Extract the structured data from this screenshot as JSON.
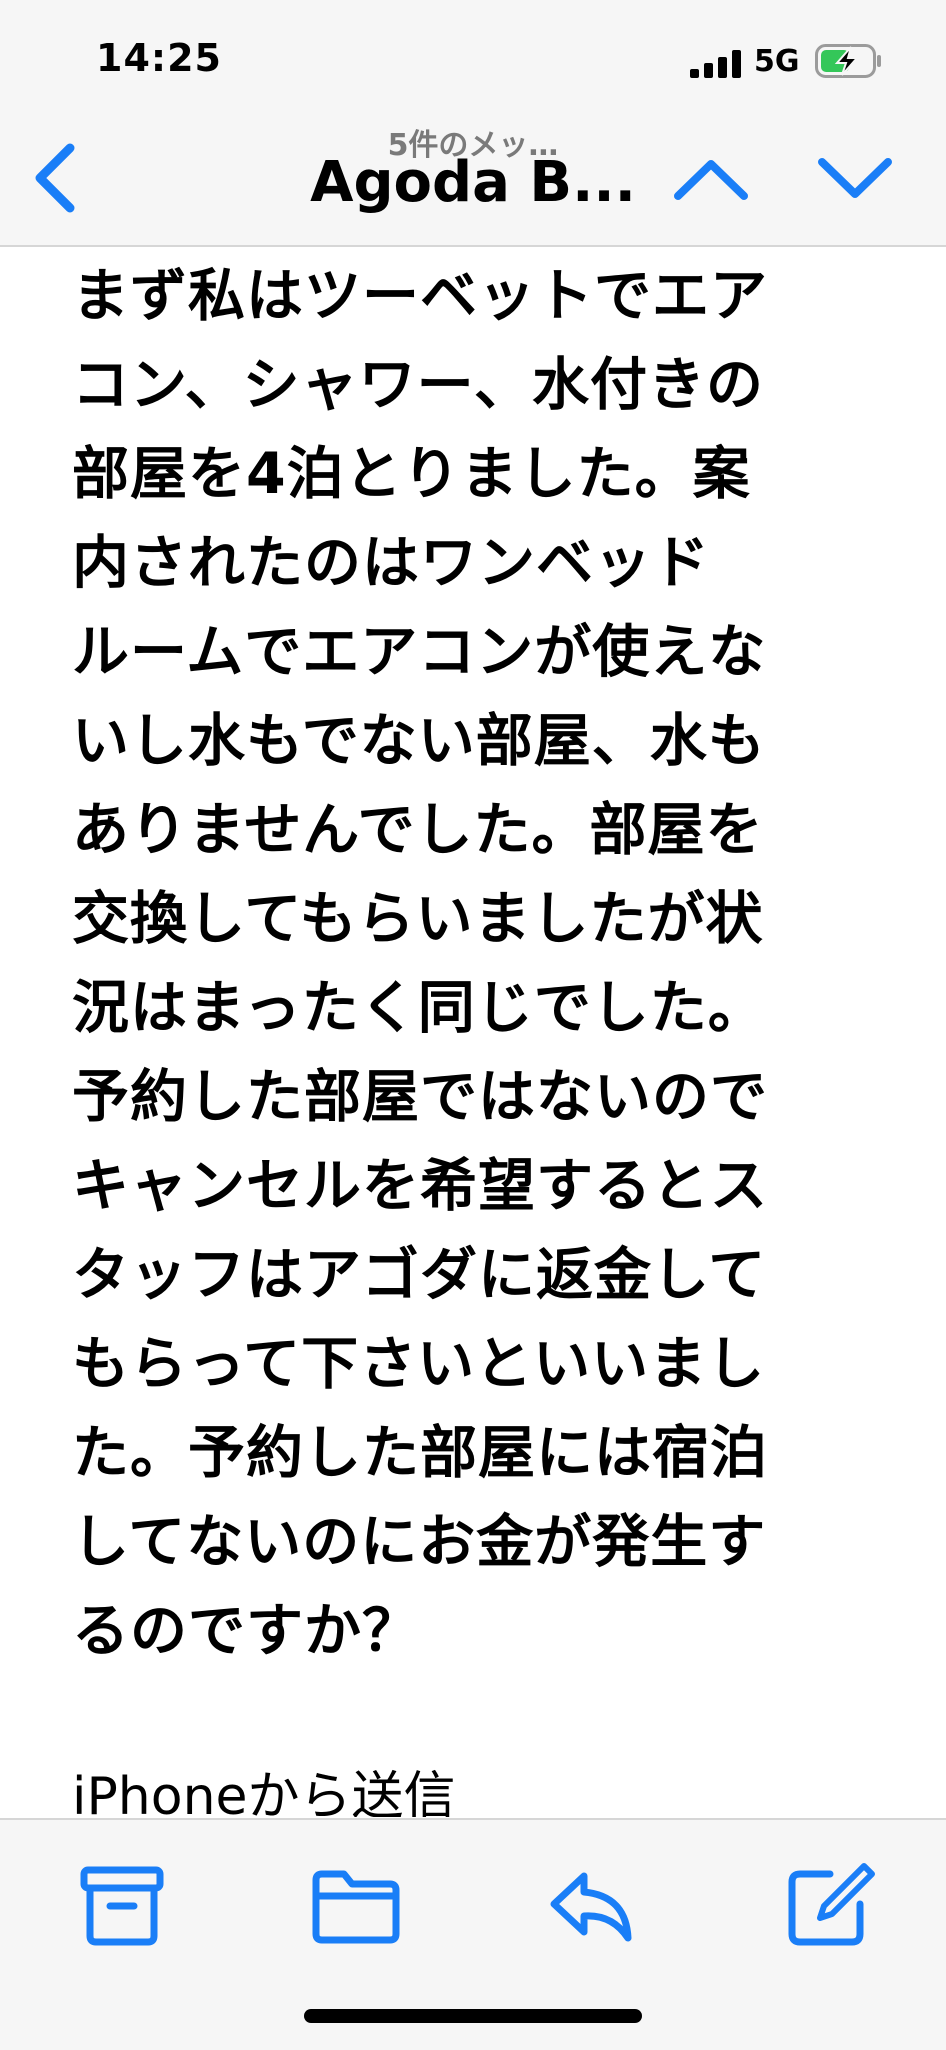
{
  "status": {
    "time": "14:25",
    "network": "5G",
    "signal_icon": "cellular-signal-icon",
    "battery_icon": "battery-charging-icon",
    "battery_color": "#34c759"
  },
  "nav": {
    "subtitle": "5件のメッ…",
    "title": "Agoda B...",
    "back_icon": "chevron-left-icon",
    "prev_icon": "chevron-up-icon",
    "next_icon": "chevron-down-icon",
    "accent": "#1a7ef7"
  },
  "message": {
    "body": "まず私はツーベットでエア\nコン、シャワー、水付きの\n部屋を4泊とりました。案\n内されたのはワンベッド\nルームでエアコンが使えな\nいし水もでない部屋、水も\nありませんでした。部屋を\n交換してもらいましたが状\n況はまったく同じでした。\n予約した部屋ではないので\nキャンセルを希望するとス\nタッフはアゴダに返金して\nもらって下さいといいまし\nた。予約した部屋には宿泊\nしてないのにお金が発生す\nるのですか？",
    "signature": "iPhoneから送信"
  },
  "toolbar": {
    "archive_icon": "archive-box-icon",
    "folder_icon": "folder-icon",
    "reply_icon": "reply-arrow-icon",
    "compose_icon": "compose-icon"
  }
}
